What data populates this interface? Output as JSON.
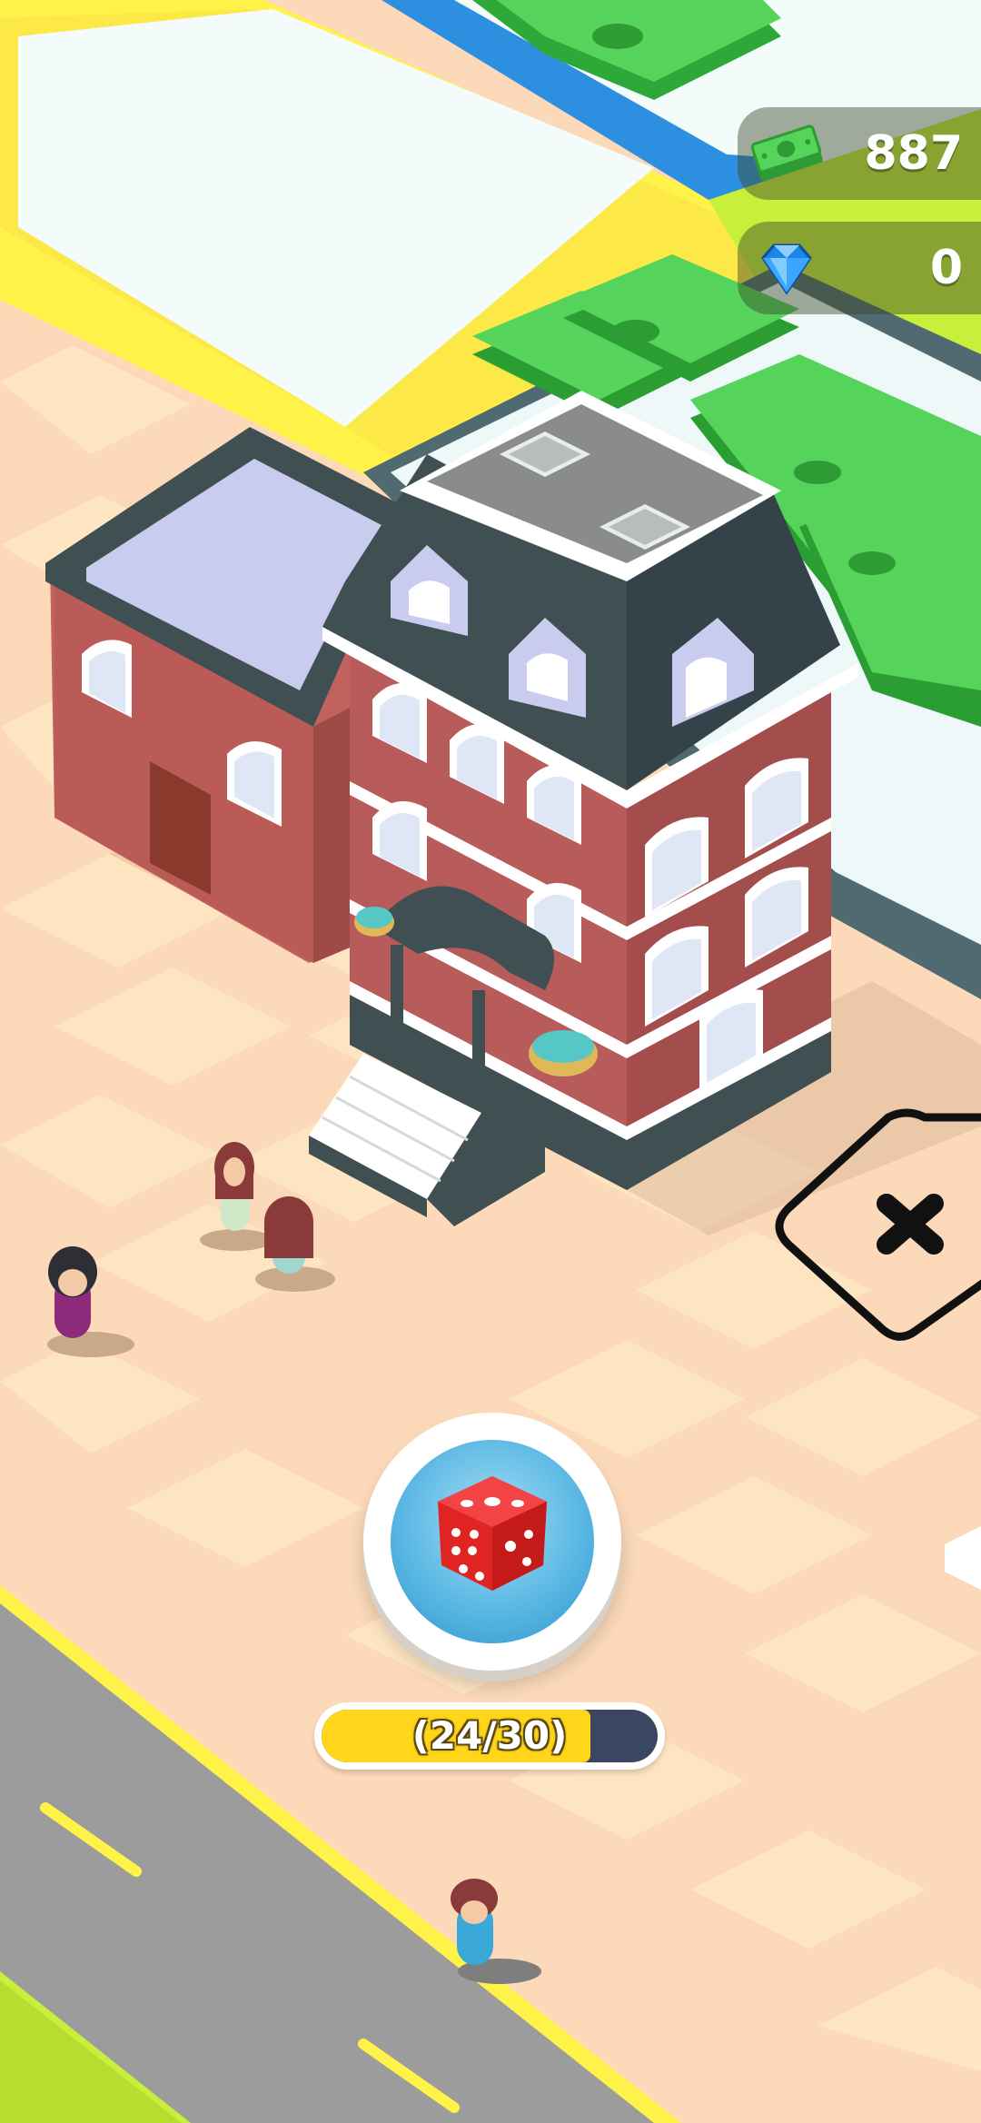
{
  "hud": {
    "cash": {
      "icon": "cash-icon",
      "value": "887"
    },
    "gems": {
      "icon": "diamond-icon",
      "value": "0"
    }
  },
  "roll": {
    "icon": "dice-icon"
  },
  "dice_meter": {
    "label": "(24/30)",
    "current": 24,
    "max": 30
  },
  "close_tile": {
    "icon": "close-icon"
  },
  "colors": {
    "ground": "#fbd9b9",
    "road": "#9c9c9c",
    "border_yellow": "#fff34a",
    "grass": "#c9ef3d",
    "brick": "#b85b5b",
    "roof": "#3f4f52",
    "cash_green": "#42c948",
    "meter_fill": "#ffd61a",
    "button_blue": "#5bb9e4"
  }
}
